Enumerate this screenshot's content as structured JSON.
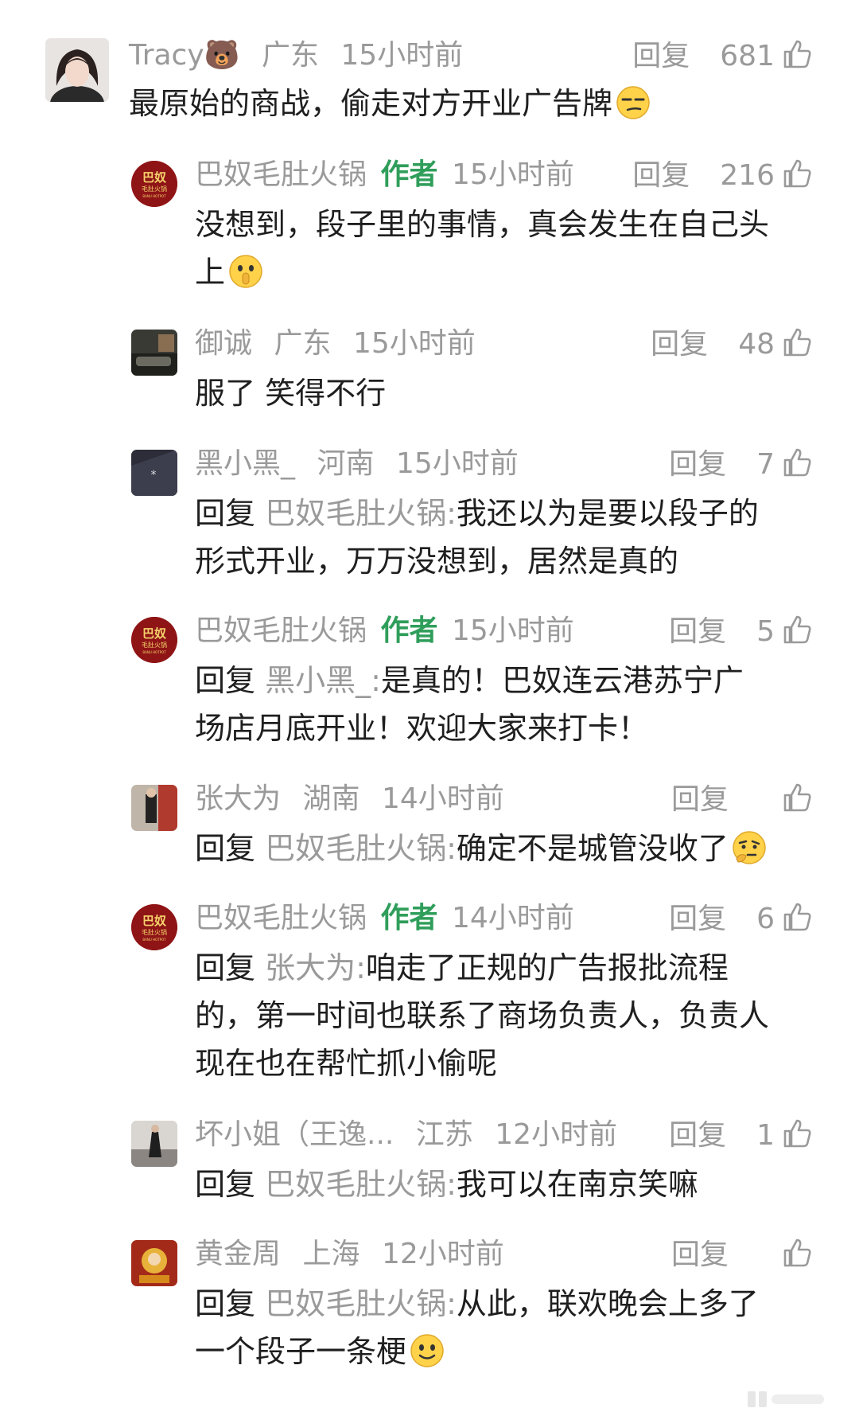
{
  "comments": [
    {
      "user": "Tracy🐻",
      "region": "广东",
      "time": "15小时前",
      "reply_label": "回复",
      "likes": "681",
      "text": "最原始的商战，偷走对方开业广告牌"
    },
    {
      "user": "巴奴毛肚火锅",
      "author_tag": "作者",
      "time": "15小时前",
      "reply_label": "回复",
      "likes": "216",
      "text_line1": "没想到，段子里的事情，真会发生在自己头",
      "text_line2": "上"
    },
    {
      "user": "御诚",
      "region": "广东",
      "time": "15小时前",
      "reply_label": "回复",
      "likes": "48",
      "text": "服了 笑得不行"
    },
    {
      "user": "黑小黑_",
      "region": "河南",
      "time": "15小时前",
      "reply_label": "回复",
      "likes": "7",
      "reply_prefix": "回复",
      "reply_target": "巴奴毛肚火锅:",
      "text_line1": "我还以为是要以段子的",
      "text_line2": "形式开业，万万没想到，居然是真的"
    },
    {
      "user": "巴奴毛肚火锅",
      "author_tag": "作者",
      "time": "15小时前",
      "reply_label": "回复",
      "likes": "5",
      "reply_prefix": "回复",
      "reply_target": "黑小黑_:",
      "text_line1": "是真的！巴奴连云港苏宁广",
      "text_line2": "场店月底开业！欢迎大家来打卡！"
    },
    {
      "user": "张大为",
      "region": "湖南",
      "time": "14小时前",
      "reply_label": "回复",
      "likes": "",
      "reply_prefix": "回复",
      "reply_target": "巴奴毛肚火锅:",
      "text_line1": "确定不是城管没收了"
    },
    {
      "user": "巴奴毛肚火锅",
      "author_tag": "作者",
      "time": "14小时前",
      "reply_label": "回复",
      "likes": "6",
      "reply_prefix": "回复",
      "reply_target": "张大为:",
      "text_line1": "咱走了正规的广告报批流程",
      "text_line2": "的，第一时间也联系了商场负责人，负责人",
      "text_line3": "现在也在帮忙抓小偷呢"
    },
    {
      "user": "坏小姐（王逸...",
      "region": "江苏",
      "time": "12小时前",
      "reply_label": "回复",
      "likes": "1",
      "reply_prefix": "回复",
      "reply_target": "巴奴毛肚火锅:",
      "text_line1": "我可以在南京笑嘛"
    },
    {
      "user": "黄金周",
      "region": "上海",
      "time": "12小时前",
      "reply_label": "回复",
      "likes": "",
      "reply_prefix": "回复",
      "reply_target": "巴奴毛肚火锅:",
      "text_line1": "从此，联欢晚会上多了",
      "text_line2": "一个段子一条梗"
    }
  ],
  "brand_logo": {
    "line1": "巴奴",
    "line2": "毛肚火锅",
    "line3": "BANU HOTPOT"
  },
  "colors": {
    "author_tag": "#2f9e5a",
    "meta": "#9a9a9a",
    "brand_red": "#8f1416"
  }
}
